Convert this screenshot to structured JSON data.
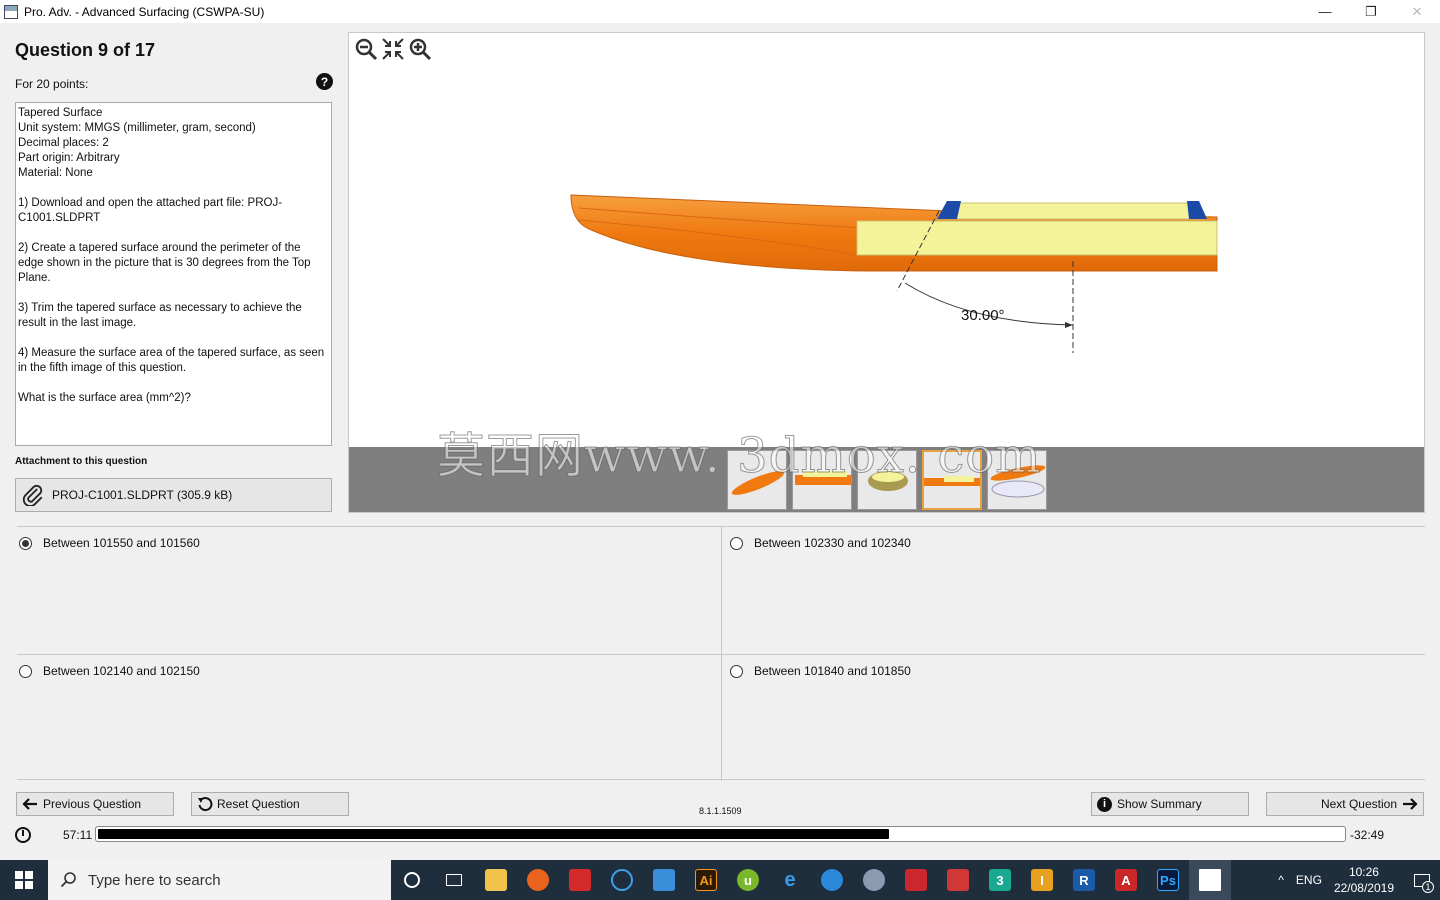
{
  "window": {
    "title": "Pro. Adv. - Advanced Surfacing (CSWPA-SU)",
    "minimize": "—",
    "restore": "❐",
    "close": "✕"
  },
  "question": {
    "title": "Question 9 of 17",
    "points": "For 20 points:",
    "help": "?",
    "text": "Tapered Surface\nUnit system: MMGS (millimeter, gram, second)\nDecimal places: 2\nPart origin: Arbitrary\nMaterial: None\n\n1) Download and open the attached part file: PROJ-C1001.SLDPRT\n\n2) Create a tapered surface around the perimeter of the edge shown in the picture that is 30 degrees from the Top Plane.\n\n3) Trim the tapered surface as necessary to achieve the result in the last image.\n\n4) Measure the surface area of the tapered surface, as seen in the fifth image of this question.\n\nWhat is the surface area (mm^2)?",
    "attachment_label": "Attachment to this question",
    "attachment_file": "PROJ-C1001.SLDPRT (305.9 kB)"
  },
  "viewer": {
    "angle_label": "30.00°",
    "watermark": "莫西网www. 3dmox. com",
    "zoom_icons": [
      "zoom-out-icon",
      "fit-icon",
      "zoom-in-icon"
    ],
    "thumbnail_count": 5,
    "active_thumbnail": 4
  },
  "answers": [
    {
      "label": "Between 101550 and 101560",
      "checked": true
    },
    {
      "label": "Between 102330 and 102340",
      "checked": false
    },
    {
      "label": "Between 102140 and 102150",
      "checked": false
    },
    {
      "label": "Between 101840 and 101850",
      "checked": false
    }
  ],
  "nav": {
    "previous": "Previous Question",
    "reset": "Reset Question",
    "version": "8.1.1.1509",
    "summary": "Show Summary",
    "next": "Next Question"
  },
  "timer": {
    "elapsed": "57:11",
    "remaining": "-32:49",
    "progress_fraction": 0.635
  },
  "taskbar": {
    "search_placeholder": "Type here to search",
    "language": "ENG",
    "time": "10:26",
    "date": "22/08/2019",
    "notification_count": "1"
  },
  "colors": {
    "hull_orange": "#f07a10",
    "deck_yellow": "#f5f39a",
    "taskbar": "#1f2e3d"
  }
}
